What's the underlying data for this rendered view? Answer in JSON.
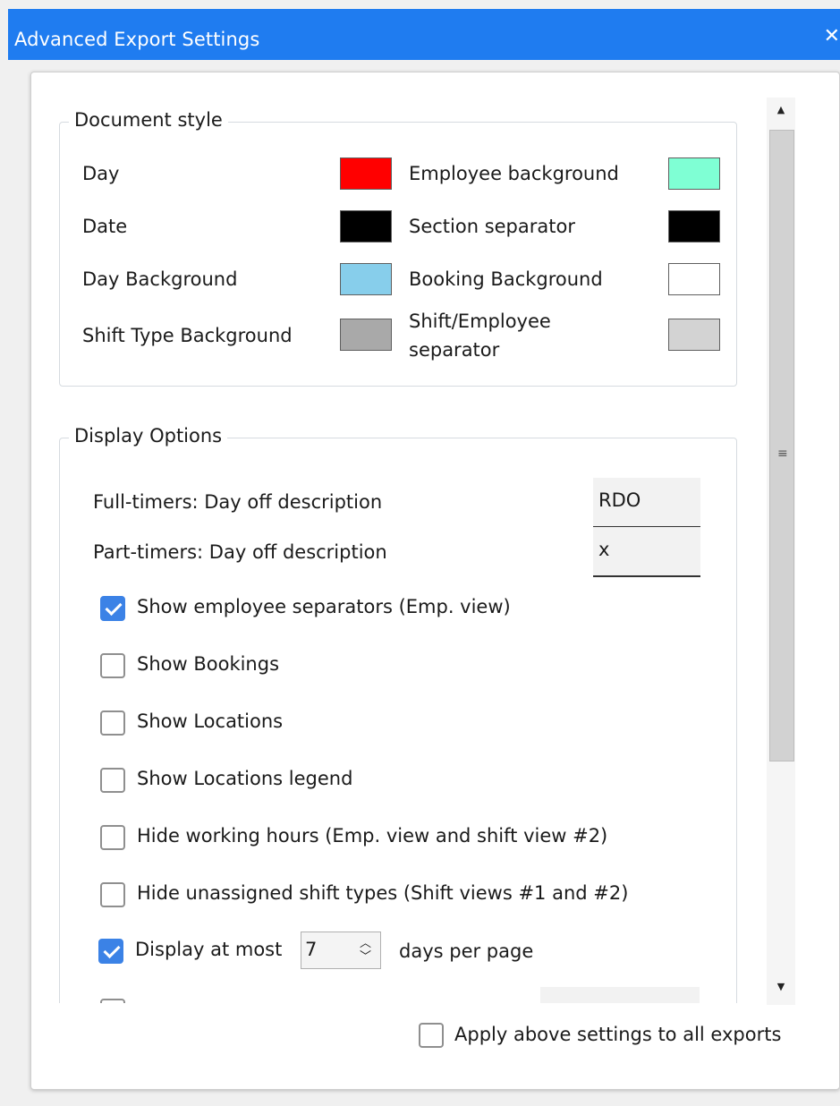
{
  "window": {
    "title": "Advanced Export Settings",
    "close_glyph": "✕"
  },
  "document_style": {
    "legend": "Document style",
    "left_items": [
      {
        "label": "Day",
        "color": "#ff0000"
      },
      {
        "label": "Date",
        "color": "#000000"
      },
      {
        "label": "Day Background",
        "color": "#87ceeb"
      },
      {
        "label": "Shift Type Background",
        "color": "#a9a9a9"
      }
    ],
    "right_items": [
      {
        "label": "Employee background",
        "color": "#7fffd4"
      },
      {
        "label": "Section separator",
        "color": "#000000"
      },
      {
        "label": "Booking Background",
        "color": "#ffffff"
      },
      {
        "label_line1": "Shift/Employee",
        "label_line2": "separator",
        "color": "#d3d3d3"
      }
    ]
  },
  "display_options": {
    "legend": "Display Options",
    "fulltimers_label": "Full-timers: Day off description",
    "fulltimers_value": "RDO",
    "parttimers_label": "Part-timers: Day off description",
    "parttimers_value": "x",
    "checkboxes": [
      {
        "label": "Show employee separators (Emp. view)",
        "checked": true
      },
      {
        "label": "Show Bookings",
        "checked": false
      },
      {
        "label": "Show Locations",
        "checked": false
      },
      {
        "label": "Show Locations legend",
        "checked": false
      },
      {
        "label": "Hide working hours (Emp. view and shift view #2)",
        "checked": false
      },
      {
        "label": "Hide unassigned shift types (Shift views #1 and #2)",
        "checked": false
      }
    ],
    "display_at_most": {
      "checked": true,
      "prefix": "Display at most",
      "value": "7",
      "suffix": "days per page"
    }
  },
  "footer": {
    "apply_all_label": "Apply above settings to all exports",
    "apply_all_checked": false
  },
  "scrollbar": {
    "up_arrow": "▲",
    "down_arrow": "▼",
    "grip": "≡"
  },
  "colors": {
    "titlebar": "#1f7cf0",
    "checkbox_checked": "#3b82e6"
  }
}
